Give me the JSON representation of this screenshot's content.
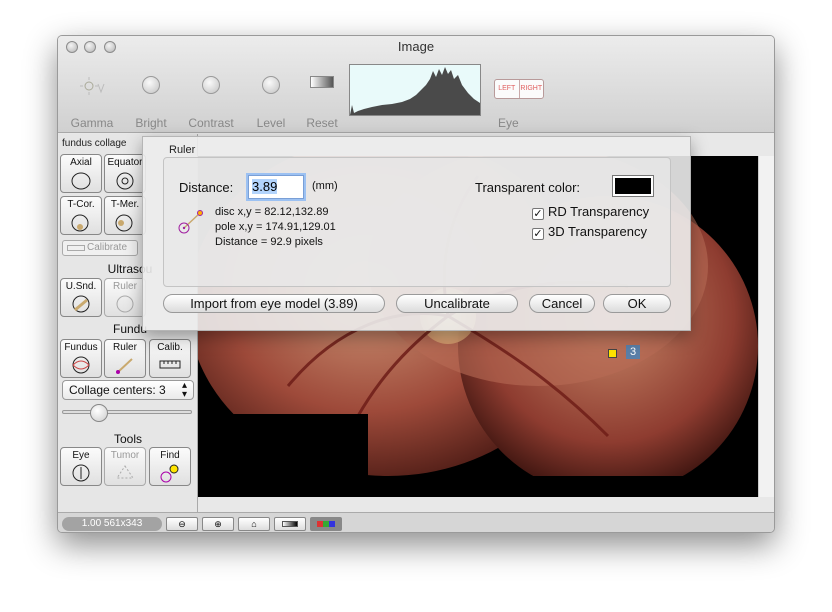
{
  "window": {
    "title": "Image"
  },
  "toolbar": {
    "tools": [
      {
        "label": "Gamma",
        "icon": "sun-icon"
      },
      {
        "label": "Bright",
        "icon": "knob-icon"
      },
      {
        "label": "Contrast",
        "icon": "knob-icon"
      },
      {
        "label": "Level",
        "icon": "knob-icon"
      },
      {
        "label": "Reset",
        "icon": "gradient-icon"
      }
    ],
    "eye": {
      "left": "LEFT",
      "right": "RIGHT",
      "label": "Eye"
    }
  },
  "sidebar": {
    "title": "fundus collage",
    "row1": [
      "Axial",
      "Equator"
    ],
    "row2": [
      "T-Cor.",
      "T-Mer."
    ],
    "calibrate_label": "Calibrate",
    "ultrasound_section": "Ultrasou",
    "ultrasound_buttons": [
      "U.Snd.",
      "Ruler"
    ],
    "fundus_section": "Fundu",
    "fundus_buttons": [
      "Fundus",
      "Ruler",
      "Calib."
    ],
    "select_value": "Collage centers: 3",
    "slider_value": 0.25,
    "tools_section": "Tools",
    "tools_buttons": [
      "Eye",
      "Tumor",
      "Find"
    ]
  },
  "viewer": {
    "marker_number": "3"
  },
  "statusbar": {
    "zoom": "1.00 561x343"
  },
  "ruler": {
    "title": "Ruler",
    "distance_label": "Distance:",
    "distance_value": "3.89",
    "unit": "(mm)",
    "transparent_label": "Transparent color:",
    "transparent_color": "#000000",
    "rd_transparency": "RD Transparency",
    "td_transparency": "3D Transparency",
    "disc": "disc x,y = 82.12,132.89",
    "pole": "pole x,y = 174.91,129.01",
    "distance_px": "Distance = 92.9 pixels",
    "buttons": {
      "import": "Import from eye model (3.89)",
      "uncalibrate": "Uncalibrate",
      "cancel": "Cancel",
      "ok": "OK"
    }
  },
  "colors": {
    "accent": "#5a7fa8",
    "marker": "#ffe400",
    "focus": "#9cc1f2"
  }
}
